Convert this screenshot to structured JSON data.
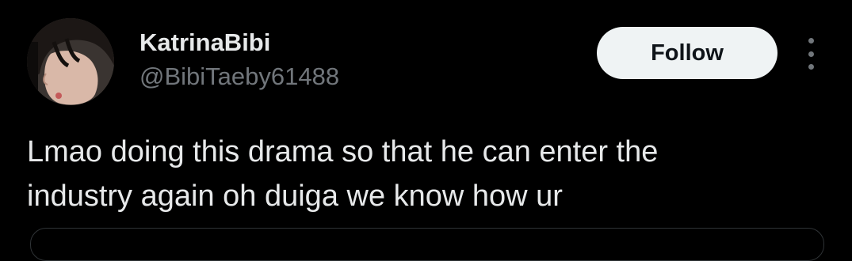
{
  "tweet": {
    "author": {
      "display_name": "KatrinaBibi",
      "handle": "@BibiTaeby61488"
    },
    "follow_label": "Follow",
    "more_icon": "more-vertical-icon",
    "text": "Lmao doing this drama so that he can enter the\nindustry again oh duiga we know how ur"
  },
  "colors": {
    "background": "#000000",
    "primary_text": "#e7e9ea",
    "secondary_text": "#71767b",
    "follow_button_bg": "#eff3f4",
    "follow_button_text": "#0f1419",
    "border": "#2f3336"
  }
}
